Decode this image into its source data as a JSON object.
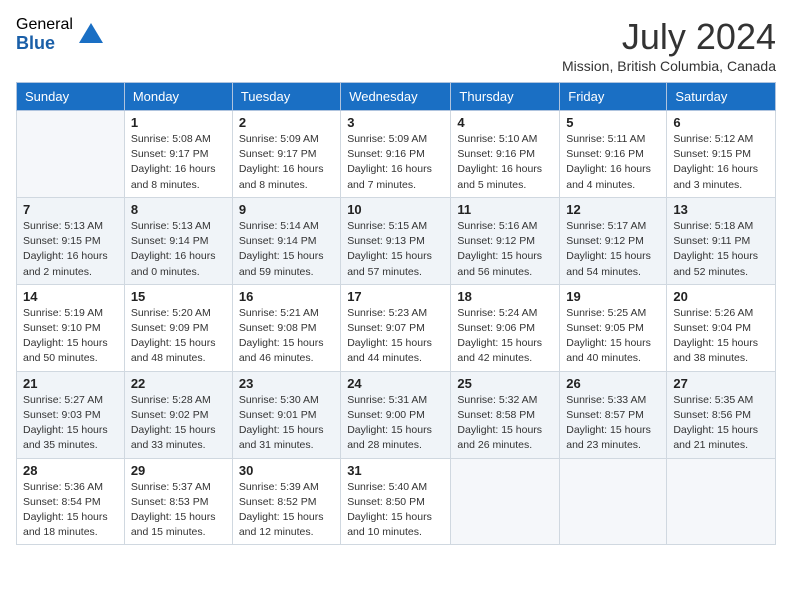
{
  "logo": {
    "general": "General",
    "blue": "Blue"
  },
  "title": "July 2024",
  "location": "Mission, British Columbia, Canada",
  "days_header": [
    "Sunday",
    "Monday",
    "Tuesday",
    "Wednesday",
    "Thursday",
    "Friday",
    "Saturday"
  ],
  "weeks": [
    [
      {
        "day": "",
        "empty": true
      },
      {
        "day": "1",
        "sunrise": "Sunrise: 5:08 AM",
        "sunset": "Sunset: 9:17 PM",
        "daylight": "Daylight: 16 hours and 8 minutes."
      },
      {
        "day": "2",
        "sunrise": "Sunrise: 5:09 AM",
        "sunset": "Sunset: 9:17 PM",
        "daylight": "Daylight: 16 hours and 8 minutes."
      },
      {
        "day": "3",
        "sunrise": "Sunrise: 5:09 AM",
        "sunset": "Sunset: 9:16 PM",
        "daylight": "Daylight: 16 hours and 7 minutes."
      },
      {
        "day": "4",
        "sunrise": "Sunrise: 5:10 AM",
        "sunset": "Sunset: 9:16 PM",
        "daylight": "Daylight: 16 hours and 5 minutes."
      },
      {
        "day": "5",
        "sunrise": "Sunrise: 5:11 AM",
        "sunset": "Sunset: 9:16 PM",
        "daylight": "Daylight: 16 hours and 4 minutes."
      },
      {
        "day": "6",
        "sunrise": "Sunrise: 5:12 AM",
        "sunset": "Sunset: 9:15 PM",
        "daylight": "Daylight: 16 hours and 3 minutes."
      }
    ],
    [
      {
        "day": "7",
        "sunrise": "Sunrise: 5:13 AM",
        "sunset": "Sunset: 9:15 PM",
        "daylight": "Daylight: 16 hours and 2 minutes."
      },
      {
        "day": "8",
        "sunrise": "Sunrise: 5:13 AM",
        "sunset": "Sunset: 9:14 PM",
        "daylight": "Daylight: 16 hours and 0 minutes."
      },
      {
        "day": "9",
        "sunrise": "Sunrise: 5:14 AM",
        "sunset": "Sunset: 9:14 PM",
        "daylight": "Daylight: 15 hours and 59 minutes."
      },
      {
        "day": "10",
        "sunrise": "Sunrise: 5:15 AM",
        "sunset": "Sunset: 9:13 PM",
        "daylight": "Daylight: 15 hours and 57 minutes."
      },
      {
        "day": "11",
        "sunrise": "Sunrise: 5:16 AM",
        "sunset": "Sunset: 9:12 PM",
        "daylight": "Daylight: 15 hours and 56 minutes."
      },
      {
        "day": "12",
        "sunrise": "Sunrise: 5:17 AM",
        "sunset": "Sunset: 9:12 PM",
        "daylight": "Daylight: 15 hours and 54 minutes."
      },
      {
        "day": "13",
        "sunrise": "Sunrise: 5:18 AM",
        "sunset": "Sunset: 9:11 PM",
        "daylight": "Daylight: 15 hours and 52 minutes."
      }
    ],
    [
      {
        "day": "14",
        "sunrise": "Sunrise: 5:19 AM",
        "sunset": "Sunset: 9:10 PM",
        "daylight": "Daylight: 15 hours and 50 minutes."
      },
      {
        "day": "15",
        "sunrise": "Sunrise: 5:20 AM",
        "sunset": "Sunset: 9:09 PM",
        "daylight": "Daylight: 15 hours and 48 minutes."
      },
      {
        "day": "16",
        "sunrise": "Sunrise: 5:21 AM",
        "sunset": "Sunset: 9:08 PM",
        "daylight": "Daylight: 15 hours and 46 minutes."
      },
      {
        "day": "17",
        "sunrise": "Sunrise: 5:23 AM",
        "sunset": "Sunset: 9:07 PM",
        "daylight": "Daylight: 15 hours and 44 minutes."
      },
      {
        "day": "18",
        "sunrise": "Sunrise: 5:24 AM",
        "sunset": "Sunset: 9:06 PM",
        "daylight": "Daylight: 15 hours and 42 minutes."
      },
      {
        "day": "19",
        "sunrise": "Sunrise: 5:25 AM",
        "sunset": "Sunset: 9:05 PM",
        "daylight": "Daylight: 15 hours and 40 minutes."
      },
      {
        "day": "20",
        "sunrise": "Sunrise: 5:26 AM",
        "sunset": "Sunset: 9:04 PM",
        "daylight": "Daylight: 15 hours and 38 minutes."
      }
    ],
    [
      {
        "day": "21",
        "sunrise": "Sunrise: 5:27 AM",
        "sunset": "Sunset: 9:03 PM",
        "daylight": "Daylight: 15 hours and 35 minutes."
      },
      {
        "day": "22",
        "sunrise": "Sunrise: 5:28 AM",
        "sunset": "Sunset: 9:02 PM",
        "daylight": "Daylight: 15 hours and 33 minutes."
      },
      {
        "day": "23",
        "sunrise": "Sunrise: 5:30 AM",
        "sunset": "Sunset: 9:01 PM",
        "daylight": "Daylight: 15 hours and 31 minutes."
      },
      {
        "day": "24",
        "sunrise": "Sunrise: 5:31 AM",
        "sunset": "Sunset: 9:00 PM",
        "daylight": "Daylight: 15 hours and 28 minutes."
      },
      {
        "day": "25",
        "sunrise": "Sunrise: 5:32 AM",
        "sunset": "Sunset: 8:58 PM",
        "daylight": "Daylight: 15 hours and 26 minutes."
      },
      {
        "day": "26",
        "sunrise": "Sunrise: 5:33 AM",
        "sunset": "Sunset: 8:57 PM",
        "daylight": "Daylight: 15 hours and 23 minutes."
      },
      {
        "day": "27",
        "sunrise": "Sunrise: 5:35 AM",
        "sunset": "Sunset: 8:56 PM",
        "daylight": "Daylight: 15 hours and 21 minutes."
      }
    ],
    [
      {
        "day": "28",
        "sunrise": "Sunrise: 5:36 AM",
        "sunset": "Sunset: 8:54 PM",
        "daylight": "Daylight: 15 hours and 18 minutes."
      },
      {
        "day": "29",
        "sunrise": "Sunrise: 5:37 AM",
        "sunset": "Sunset: 8:53 PM",
        "daylight": "Daylight: 15 hours and 15 minutes."
      },
      {
        "day": "30",
        "sunrise": "Sunrise: 5:39 AM",
        "sunset": "Sunset: 8:52 PM",
        "daylight": "Daylight: 15 hours and 12 minutes."
      },
      {
        "day": "31",
        "sunrise": "Sunrise: 5:40 AM",
        "sunset": "Sunset: 8:50 PM",
        "daylight": "Daylight: 15 hours and 10 minutes."
      },
      {
        "day": "",
        "empty": true
      },
      {
        "day": "",
        "empty": true
      },
      {
        "day": "",
        "empty": true
      }
    ]
  ]
}
